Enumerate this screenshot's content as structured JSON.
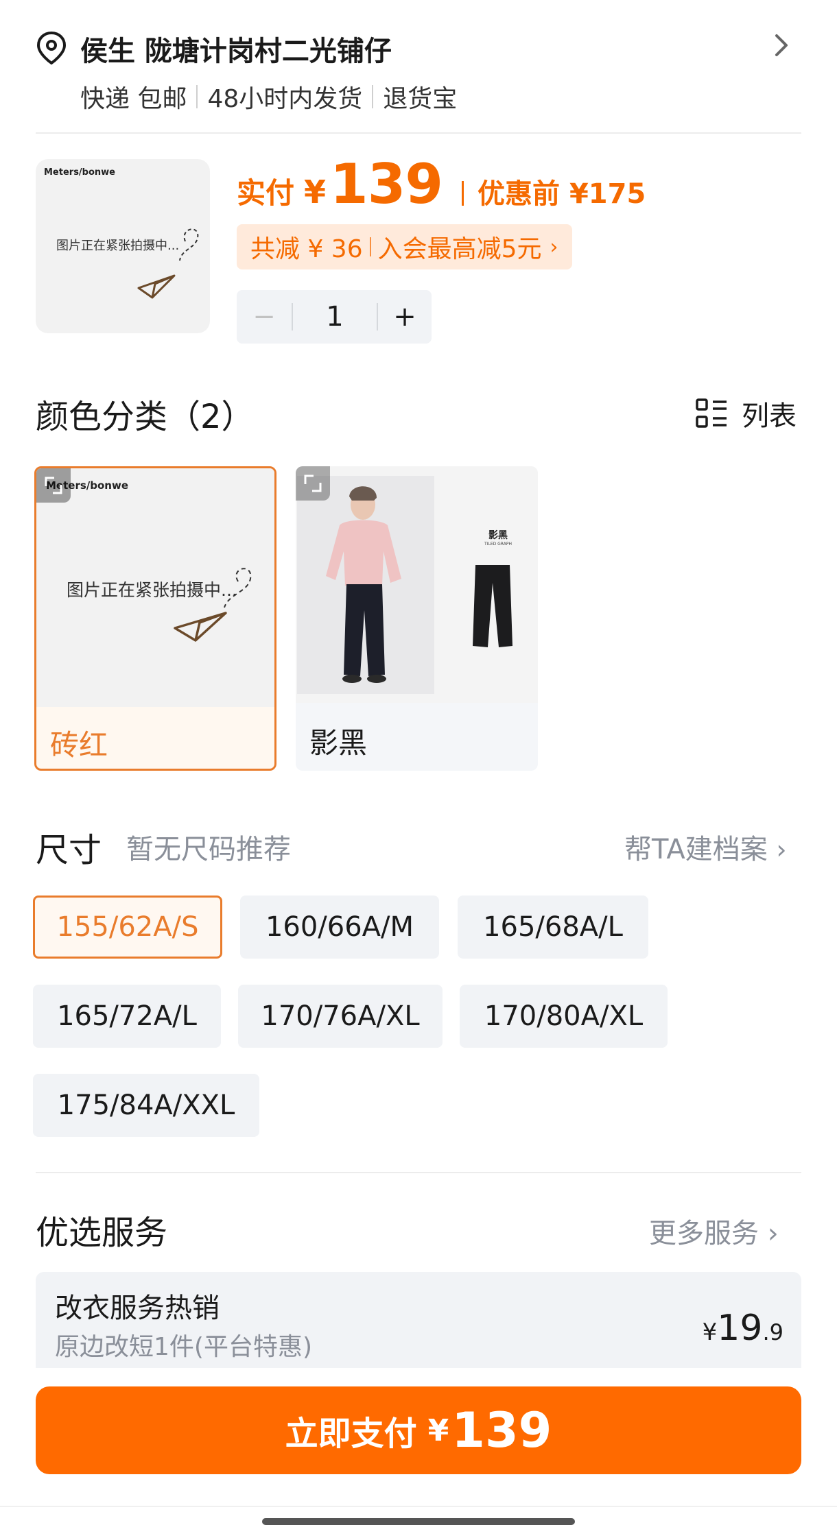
{
  "address": {
    "name": "侯生  陇塘计岗村二光铺仔",
    "tags": [
      "快递 包邮",
      "48小时内发货",
      "退货宝"
    ]
  },
  "product": {
    "thumb_brand": "Meters/bonwe",
    "thumb_placeholder": "图片正在紧张拍摄中...",
    "pay_label": "实付",
    "currency": "¥",
    "price": "139",
    "original_label": "优惠前 ¥175",
    "discount_total": "共减 ¥ 36",
    "discount_member": "入会最高减5元",
    "quantity": "1"
  },
  "color_section": {
    "title": "颜色分类（2）",
    "list_label": "列表",
    "options": [
      {
        "label": "砖红",
        "selected": true,
        "brand": "Meters/bonwe",
        "placeholder": "图片正在紧张拍摄中..."
      },
      {
        "label": "影黑",
        "selected": false,
        "tag_title": "影黑",
        "tag_sub": "TILED GRAPH"
      }
    ]
  },
  "size_section": {
    "title": "尺寸",
    "hint": "暂无尺码推荐",
    "profile_link": "帮TA建档案",
    "sizes": [
      "155/62A/S",
      "160/66A/M",
      "165/68A/L",
      "165/72A/L",
      "170/76A/XL",
      "170/80A/XL",
      "175/84A/XXL"
    ],
    "selected_index": 0
  },
  "services": {
    "title": "优选服务",
    "more": "更多服务",
    "card": {
      "title": "改衣服务热销",
      "subtitle": "原边改短1件(平台特惠)",
      "currency": "¥",
      "price_int": "19",
      "price_dec": ".9"
    }
  },
  "pay_button": {
    "label": "立即支付",
    "currency": "¥",
    "amount": "139"
  },
  "colors": {
    "accent": "#ff6a00",
    "selected_border": "#e97c2c",
    "chip_bg": "#f1f3f6"
  }
}
